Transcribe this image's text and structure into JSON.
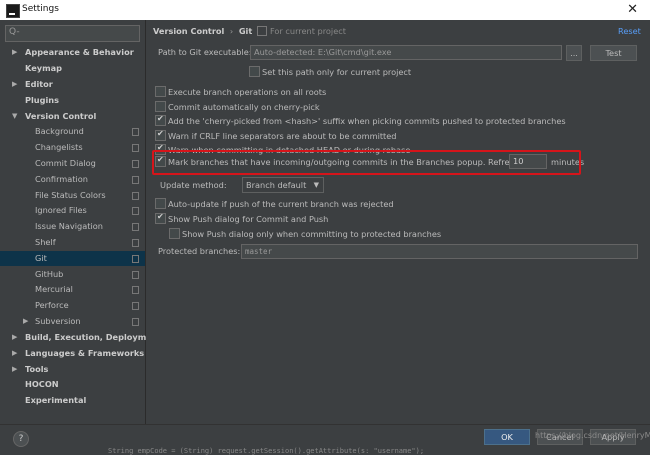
{
  "window": {
    "title": "Settings",
    "close_glyph": "✕"
  },
  "search": {
    "placeholder": "Q-"
  },
  "sidebar": {
    "items": [
      {
        "label": "Appearance & Behavior",
        "bold": true,
        "arrow": "▶"
      },
      {
        "label": "Keymap",
        "bold": true
      },
      {
        "label": "Editor",
        "bold": true,
        "arrow": "▶"
      },
      {
        "label": "Plugins",
        "bold": true
      },
      {
        "label": "Version Control",
        "bold": true,
        "arrow": "▼"
      },
      {
        "label": "Background"
      },
      {
        "label": "Changelists"
      },
      {
        "label": "Commit Dialog"
      },
      {
        "label": "Confirmation"
      },
      {
        "label": "File Status Colors"
      },
      {
        "label": "Ignored Files"
      },
      {
        "label": "Issue Navigation"
      },
      {
        "label": "Shelf"
      },
      {
        "label": "Git",
        "selected": true
      },
      {
        "label": "GitHub"
      },
      {
        "label": "Mercurial"
      },
      {
        "label": "Perforce"
      },
      {
        "label": "Subversion",
        "arrow": "▶"
      },
      {
        "label": "Build, Execution, Deployment",
        "bold": true,
        "arrow": "▶"
      },
      {
        "label": "Languages & Frameworks",
        "bold": true,
        "arrow": "▶"
      },
      {
        "label": "Tools",
        "bold": true,
        "arrow": "▶"
      },
      {
        "label": "HOCON",
        "bold": true
      },
      {
        "label": "Experimental",
        "bold": true
      }
    ]
  },
  "header": {
    "crumb_parent": "Version Control",
    "separator": "›",
    "crumb_current": "Git",
    "scope_note": "For current project",
    "reset": "Reset"
  },
  "git": {
    "path_label": "Path to Git executable:",
    "path_value": "Auto-detected: E:\\Git\\cmd\\git.exe",
    "browse": "...",
    "test": "Test",
    "set_path_label": "Set this path only for current project",
    "options": [
      {
        "label": "Execute branch operations on all roots",
        "checked": false
      },
      {
        "label": "Commit automatically on cherry-pick",
        "checked": false
      },
      {
        "label": "Add the 'cherry-picked from <hash>' suffix when picking commits pushed to protected branches",
        "checked": true
      },
      {
        "label": "Warn if CRLF line separators are about to be committed",
        "checked": true
      },
      {
        "label": "Warn when committing in detached HEAD or during rebase",
        "checked": true
      }
    ],
    "mark_branches_label": "Mark branches that have incoming/outgoing commits in the Branches popup.  Refresh every",
    "refresh_value": "10",
    "refresh_unit": "minutes",
    "update_method_label": "Update method:",
    "update_method_value": "Branch default",
    "auto_update_label": "Auto-update if push of the current branch was rejected",
    "show_push_label": "Show Push dialog for Commit and Push",
    "show_push_protected_label": "Show Push dialog only when committing to protected branches",
    "protected_label": "Protected branches:",
    "protected_value": "master"
  },
  "footer": {
    "help": "?",
    "ok": "OK",
    "cancel": "Cancel",
    "apply": "Apply",
    "watermark": "https://blog.csdn.net/HenryMrZ",
    "code_behind": "String empCode = (String) request.getSession().getAttribute(s: \"username\");"
  },
  "colors": {
    "selection": "#0d3349",
    "highlight_box": "#d6141a",
    "ok_button": "#365880",
    "reset_link": "#589df6"
  }
}
